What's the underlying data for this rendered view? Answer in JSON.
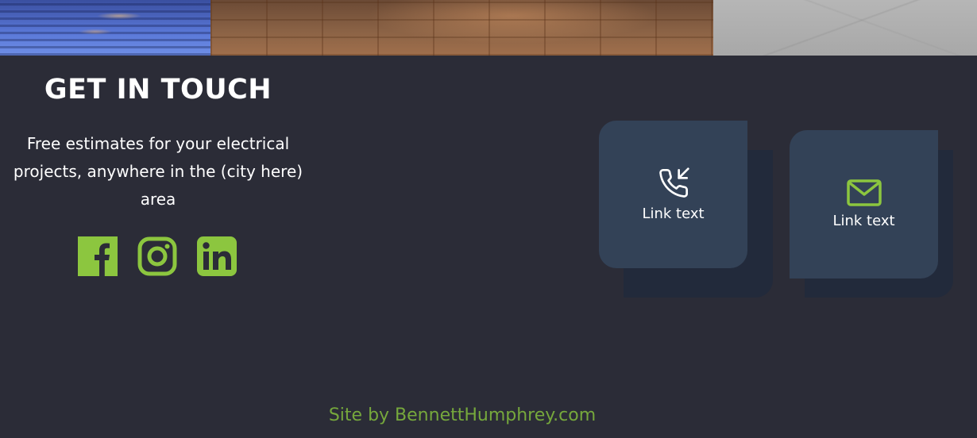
{
  "gallery": {
    "photos": [
      "water-reflection-photo",
      "gate-photo",
      "stone-floor-photo"
    ]
  },
  "contact": {
    "title": "GET IN TOUCH",
    "description": "Free estimates for your electrical projects, anywhere in the (city here) area"
  },
  "social": {
    "icons": [
      "facebook-icon",
      "instagram-icon",
      "linkedin-icon"
    ],
    "color": "#8cc63f"
  },
  "cards": [
    {
      "label": "Link text",
      "icon": "phone-incoming-icon",
      "icon_color": "#ffffff"
    },
    {
      "label": "Link text",
      "icon": "mail-icon",
      "icon_color": "#8cc63f"
    }
  ],
  "footer": {
    "credit": "Site by BennettHumphrey.com",
    "credit_color": "#76a83c"
  },
  "colors": {
    "background": "#2b2c37",
    "card": "#334257",
    "card_shadow": "#222a3b",
    "accent": "#8cc63f"
  }
}
